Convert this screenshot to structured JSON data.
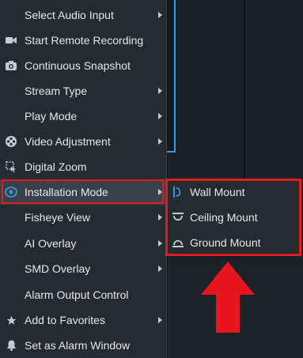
{
  "menu": {
    "items": [
      {
        "label": "Select Audio Input",
        "icon": "",
        "submenu": true
      },
      {
        "label": "Start Remote Recording",
        "icon": "video-camera-icon",
        "submenu": false
      },
      {
        "label": "Continuous Snapshot",
        "icon": "camera-icon",
        "submenu": false
      },
      {
        "label": "Stream Type",
        "icon": "",
        "submenu": true
      },
      {
        "label": "Play Mode",
        "icon": "",
        "submenu": true
      },
      {
        "label": "Video Adjustment",
        "icon": "film-reel-icon",
        "submenu": true
      },
      {
        "label": "Digital Zoom",
        "icon": "zoom-select-icon",
        "submenu": false
      },
      {
        "label": "Installation Mode",
        "icon": "fisheye-icon",
        "submenu": true,
        "active": true
      },
      {
        "label": "Fisheye View",
        "icon": "",
        "submenu": true
      },
      {
        "label": "AI Overlay",
        "icon": "",
        "submenu": true
      },
      {
        "label": "SMD Overlay",
        "icon": "",
        "submenu": true
      },
      {
        "label": "Alarm Output Control",
        "icon": "",
        "submenu": false
      },
      {
        "label": "Add to Favorites",
        "icon": "star-icon",
        "submenu": true
      },
      {
        "label": "Set as Alarm Window",
        "icon": "bell-icon",
        "submenu": false
      }
    ]
  },
  "submenu": {
    "items": [
      {
        "label": "Wall Mount",
        "icon": "wall-mount-icon"
      },
      {
        "label": "Ceiling Mount",
        "icon": "ceiling-mount-icon"
      },
      {
        "label": "Ground Mount",
        "icon": "ground-mount-icon"
      }
    ]
  },
  "colors": {
    "highlight": "#e01b24",
    "accent": "#2f9be0",
    "menu_bg": "#262b30",
    "active_bg": "#3a4149"
  }
}
